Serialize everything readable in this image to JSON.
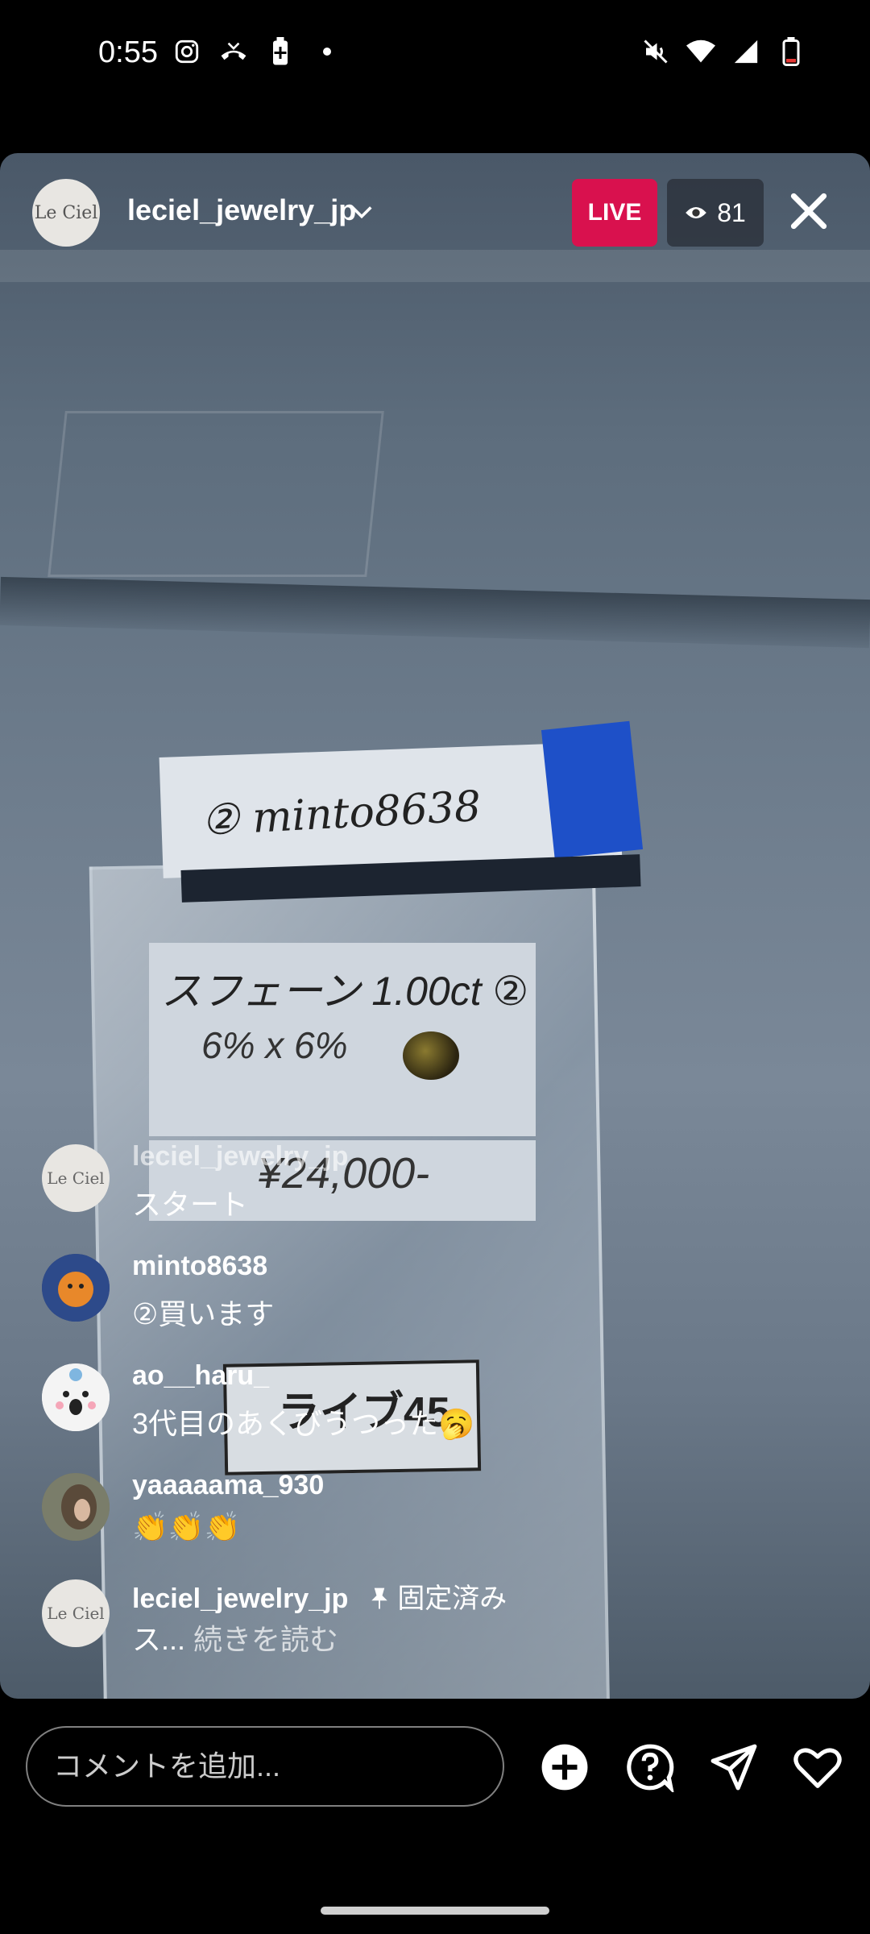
{
  "status_bar": {
    "time": "0:55",
    "left_icons": [
      "instagram-icon",
      "missed-call-icon",
      "battery-saver-icon",
      "dot-icon"
    ],
    "right_icons": [
      "mute-icon",
      "wifi-icon",
      "signal-icon",
      "battery-icon"
    ]
  },
  "header": {
    "host_avatar_text": "Le Ciel",
    "host_username": "leciel_jewelry_jp",
    "live_label": "LIVE",
    "viewer_count": "81"
  },
  "video_scene": {
    "bag_label_top": "② minto8638",
    "bag_label_line1": "スフェーン 1.00ct ②",
    "bag_label_line2": "6% x 6%",
    "bag_label_price": "¥24,000-",
    "tag": "ライブ45"
  },
  "comments": [
    {
      "user": "leciel_jewelry_jp",
      "text": "スタート",
      "avatar": "leciel-logo",
      "dim": true
    },
    {
      "user": "minto8638",
      "text": "②買います",
      "avatar": "orange-character"
    },
    {
      "user": "ao__haru_",
      "text": "3代目のあくびうつった🥱",
      "avatar": "cartoon-face"
    },
    {
      "user": "yaaaaama_930",
      "text": "👏👏👏",
      "avatar": "photo"
    },
    {
      "user": "leciel_jewelry_jp",
      "pinned_label": "固定済み",
      "text": "ス...",
      "read_more": "続きを読む",
      "avatar": "leciel-logo"
    }
  ],
  "bottom_bar": {
    "comment_placeholder": "コメントを追加..."
  }
}
